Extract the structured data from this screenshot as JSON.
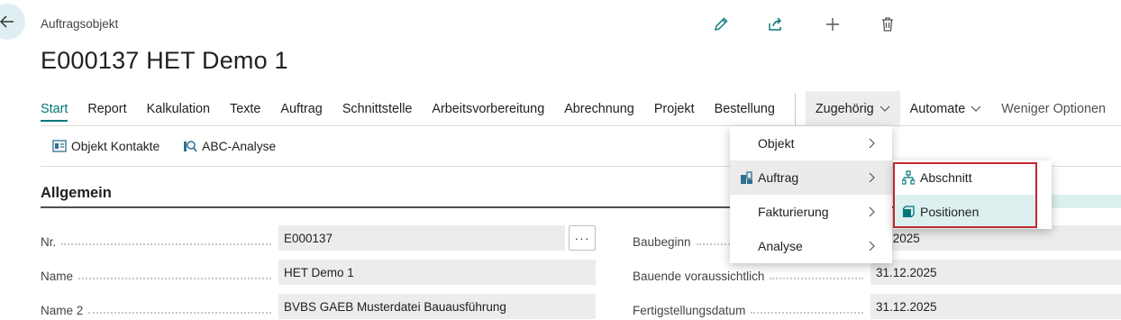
{
  "header": {
    "caption": "Auftragsobjekt",
    "title": "E000137 HET Demo 1",
    "toolbar": [
      {
        "icon": "edit-icon"
      },
      {
        "icon": "share-icon"
      },
      {
        "icon": "new-icon"
      },
      {
        "icon": "delete-icon"
      }
    ]
  },
  "tabs": {
    "start": "Start",
    "report": "Report",
    "kalkulation": "Kalkulation",
    "texte": "Texte",
    "auftrag": "Auftrag",
    "schnittstelle": "Schnittstelle",
    "arbeitsvorbereitung": "Arbeitsvorbereitung",
    "abrechnung": "Abrechnung",
    "projekt": "Projekt",
    "bestellung": "Bestellung",
    "zugehoerig": "Zugehörig",
    "automate": "Automate",
    "weniger": "Weniger Optionen"
  },
  "actions": {
    "objekt_kontakte": "Objekt Kontakte",
    "abc_analyse": "ABC-Analyse"
  },
  "section": {
    "title": "Allgemein"
  },
  "fields": {
    "nr_label": "Nr.",
    "nr_value": "E000137",
    "name_label": "Name",
    "name_value": "HET Demo 1",
    "name2_label": "Name 2",
    "name2_value": "BVBS GAEB Musterdatei Bauausführung",
    "baubeginn_label": "Baubeginn",
    "baubeginn_value": "01.2025",
    "bauende_label": "Bauende voraussichtlich",
    "bauende_value": "31.12.2025",
    "fertig_label": "Fertigstellungsdatum",
    "fertig_value": "31.12.2025",
    "ellipsis": "···"
  },
  "menu": {
    "objekt": "Objekt",
    "auftrag": "Auftrag",
    "fakturierung": "Fakturierung",
    "analyse": "Analyse"
  },
  "submenu": {
    "abschnitt": "Abschnitt",
    "positionen": "Positionen"
  },
  "colors": {
    "accent": "#00777a",
    "highlight_border": "#c0262e",
    "hover_bg": "#dcf0f0"
  }
}
